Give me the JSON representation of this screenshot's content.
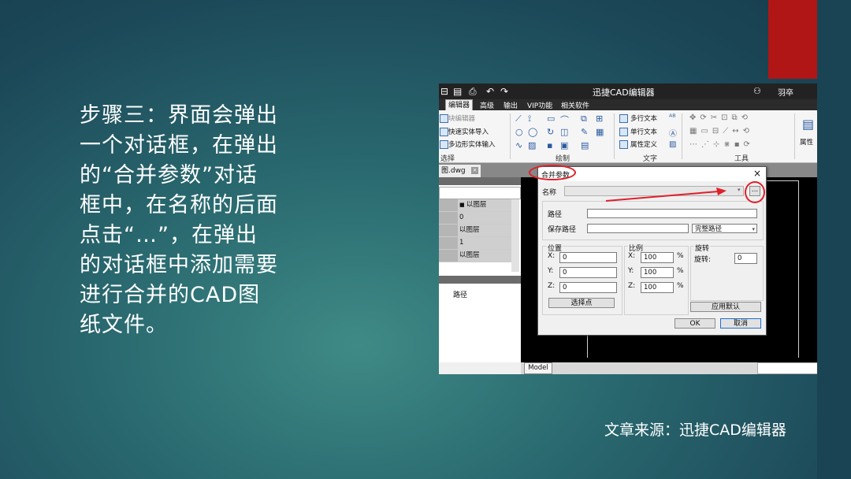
{
  "slide": {
    "step_text": "步骤三：界面会弹出\n一个对话框，在弹出\n的“合并参数”对话\n框中，在名称的后面\n点击“…”，在弹出\n的对话框中添加需要\n进行合并的CAD图\n纸文件。",
    "source": "文章来源：迅捷CAD编辑器",
    "accent_color": "#b01616"
  },
  "app": {
    "title": "迅捷CAD编辑器",
    "user": "羽卒",
    "menu": [
      "编辑器",
      "高级",
      "输出",
      "VIP功能",
      "相关软件"
    ],
    "active_menu": "编辑器"
  },
  "ribbon": {
    "select_items": [
      "块编辑器",
      "快速实体导入",
      "多边形实体输入"
    ],
    "select_group": "选择",
    "draw_group": "绘制",
    "text_items": [
      "多行文本",
      "单行文本",
      "属性定义"
    ],
    "text_group": "文字",
    "tools_group": "工具",
    "properties_label": "属性"
  },
  "document": {
    "tab_label": "图.dwg",
    "layer_rows": [
      "以图层",
      "0",
      "以图层",
      "1",
      "以图层"
    ],
    "property_label": "路径",
    "model_tab": "Model"
  },
  "dialog": {
    "title": "合并参数",
    "close": "×",
    "name_label": "名称",
    "name_value": "",
    "browse_button": "...",
    "path_label": "路径",
    "path_value": "",
    "save_path_label": "保存路径",
    "save_path_value": "",
    "path_mode": "完整路径",
    "position": {
      "title": "位置",
      "x_label": "X:",
      "x": "0",
      "y_label": "Y:",
      "y": "0",
      "z_label": "Z:",
      "z": "0",
      "pick_button": "选择点"
    },
    "scale": {
      "title": "比例",
      "x_label": "X:",
      "x": "100",
      "y_label": "Y:",
      "y": "100",
      "z_label": "Z:",
      "z": "100",
      "unit": "%"
    },
    "rotation": {
      "title": "旋转",
      "label": "旋转:",
      "value": "0"
    },
    "apply_default": "应用默认",
    "ok": "OK",
    "cancel": "取消"
  }
}
